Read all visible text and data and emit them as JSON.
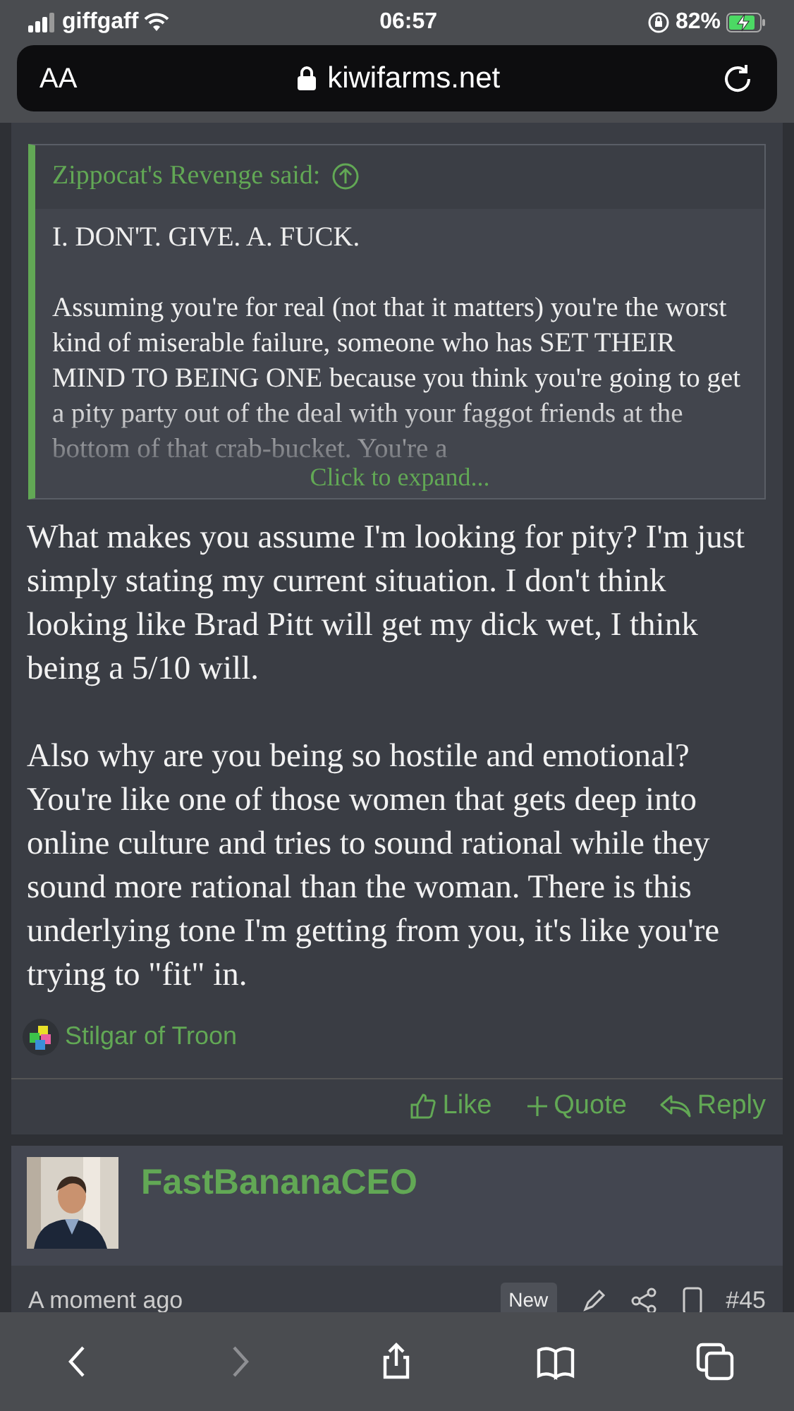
{
  "status_bar": {
    "carrier": "giffgaff",
    "time": "06:57",
    "battery": "82%"
  },
  "address_bar": {
    "text_size": "AA",
    "url": "kiwifarms.net"
  },
  "quote": {
    "author": "Zippocat's Revenge said:",
    "paragraphs": [
      "I. DON'T. GIVE. A. FUCK.",
      "Assuming you're for real (not that it matters) you're the worst kind of miserable failure, someone who has SET THEIR MIND TO BEING ONE because you think you're going to get a pity party out of the deal with your faggot friends at the bottom of that crab-bucket. You're a"
    ],
    "expand": "Click to expand..."
  },
  "post": {
    "paragraphs": [
      "What makes you assume I'm looking for pity? I'm just simply stating my current situation. I don't think looking like Brad Pitt will get my dick wet, I think being a 5/10 will.",
      "Also why are you being so hostile and emotional? You're like one of those women that gets deep into online culture and tries to sound rational while they sound more rational than the woman. There is this underlying tone I'm getting from you, it's like you're trying to \"fit\" in."
    ],
    "reaction_user": "Stilgar of Troon",
    "actions": [
      {
        "kind": "like",
        "label": "Like"
      },
      {
        "kind": "quote",
        "label": "Quote"
      },
      {
        "kind": "reply",
        "label": "Reply"
      }
    ]
  },
  "next_post": {
    "username": "FastBananaCEO",
    "time": "A moment ago",
    "badge": "New",
    "number": "#45"
  },
  "toolbar": [
    {
      "kind": "back",
      "disabled": false
    },
    {
      "kind": "forward",
      "disabled": true
    },
    {
      "kind": "share",
      "disabled": false
    },
    {
      "kind": "bookmarks",
      "disabled": false
    },
    {
      "kind": "tabs",
      "disabled": false
    }
  ]
}
